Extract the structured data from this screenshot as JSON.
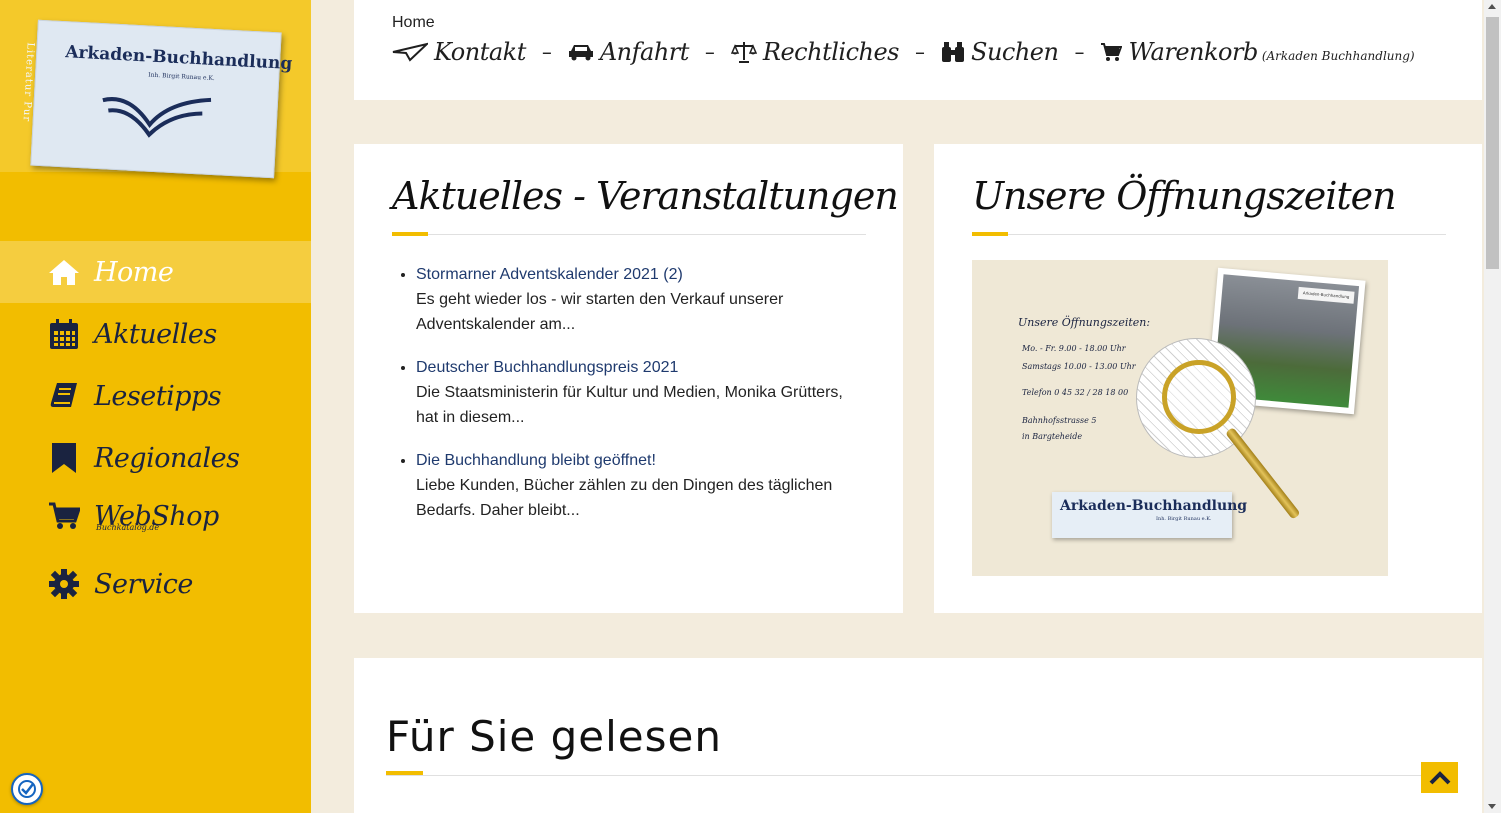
{
  "sidebar": {
    "logo": {
      "title": "Arkaden-Buchhandlung",
      "subtitle": "Inh. Birgit Runau e.K.",
      "side_text": "Literatur Pur"
    },
    "items": [
      {
        "label": "Home",
        "icon": "home-icon",
        "active": true
      },
      {
        "label": "Aktuelles",
        "icon": "calendar-icon"
      },
      {
        "label": "Lesetipps",
        "icon": "book-icon"
      },
      {
        "label": "Regionales",
        "icon": "bookmark-icon"
      },
      {
        "label": "WebShop",
        "sub": "Buchkatalog.de",
        "icon": "cart-icon"
      },
      {
        "label": "Service",
        "icon": "gear-icon"
      }
    ]
  },
  "topbar": {
    "breadcrumb": "Home",
    "nav": [
      {
        "label": "Kontakt",
        "icon": "paper-plane-icon"
      },
      {
        "label": "Anfahrt",
        "icon": "car-icon"
      },
      {
        "label": "Rechtliches",
        "icon": "balance-scale-icon"
      },
      {
        "label": "Suchen",
        "icon": "binoculars-icon"
      },
      {
        "label": "Warenkorb",
        "small": "(Arkaden Buchhandlung)",
        "icon": "cart-icon"
      }
    ],
    "separator": "–"
  },
  "news": {
    "title": "Aktuelles - Veranstaltungen",
    "items": [
      {
        "link": "Stormarner Adventskalender 2021 (2)",
        "excerpt": "Es geht wieder los - wir starten den Verkauf unserer Adventskalender am..."
      },
      {
        "link": "Deutscher Buchhandlungspreis 2021",
        "excerpt": "Die Staatsministerin für Kultur und Medien, Monika Grütters, hat in diesem..."
      },
      {
        "link": "Die Buchhandlung bleibt geöffnet!",
        "excerpt": "Liebe Kunden, Bücher zählen zu den Dingen des täglichen Bedarfs. Daher bleibt..."
      }
    ]
  },
  "hours": {
    "title": "Unsere Öffnungszeiten",
    "image": {
      "heading": "Unsere Öffnungszeiten:",
      "lines": [
        "Mo. - Fr.   9.00 - 18.00 Uhr",
        "Samstags   10.00 - 13.00 Uhr",
        "Telefon 0 45 32 / 28 18 00",
        "Bahnhofsstrasse 5",
        "in Bargteheide"
      ],
      "card_title": "Arkaden-Buchhandlung",
      "card_sub": "Inh. Birgit Runau e.K.",
      "photo_sign": "Arkaden-Buchhandlung"
    }
  },
  "read_section": {
    "title": "Für Sie gelesen"
  },
  "colors": {
    "accent": "#f2bd00",
    "link": "#1f3a6e",
    "background": "#f3ecdd"
  }
}
